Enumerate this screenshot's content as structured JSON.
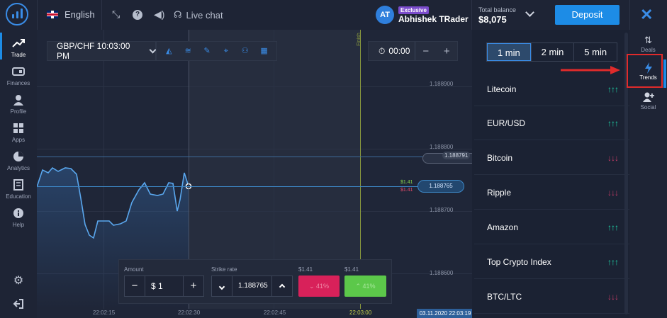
{
  "topbar": {
    "language": "English",
    "live_chat": "Live chat",
    "user_initials": "AT",
    "user_badge": "Exclusive",
    "user_name": "Abhishek TRader",
    "balance_label": "Total balance",
    "balance_value": "$8,075",
    "deposit_label": "Deposit"
  },
  "leftnav": [
    {
      "label": "Trade",
      "icon": "trend-icon"
    },
    {
      "label": "Finances",
      "icon": "wallet-icon"
    },
    {
      "label": "Profile",
      "icon": "user-icon"
    },
    {
      "label": "Apps",
      "icon": "grid-icon"
    },
    {
      "label": "Analytics",
      "icon": "pie-icon"
    },
    {
      "label": "Education",
      "icon": "book-icon"
    },
    {
      "label": "Help",
      "icon": "info-icon"
    }
  ],
  "chart": {
    "pair_label": "GBP/CHF 10:03:00 PM",
    "timer_value": "00:00",
    "finish_label": "Finish",
    "y_ticks": [
      "1.188900",
      "1.188800",
      "1.188700",
      "1.188600"
    ],
    "x_ticks": [
      "22:02:15",
      "22:02:30",
      "22:02:45",
      "22:03:00"
    ],
    "time_tag": "03.11.2020 22:03:19",
    "strike_tag": "1.188791",
    "current_tag": "1.188765",
    "payout_up": "$1.41",
    "payout_down": "$1.41",
    "colors": {
      "line": "#5aa7ee",
      "up": "#5cc84a",
      "down": "#d8215a"
    }
  },
  "trade_panel": {
    "amount_label": "Amount",
    "amount_value": "$ 1",
    "strike_label": "Strike rate",
    "strike_value": "1.188765",
    "payout_down_label": "$1.41",
    "payout_up_label": "$1.41",
    "down_pct": "41%",
    "up_pct": "41%"
  },
  "right_panel": {
    "timeframes": [
      "1 min",
      "2 min",
      "5 min"
    ],
    "assets": [
      {
        "name": "Litecoin",
        "trend": "↑↑↑",
        "color": "#1fd3a7"
      },
      {
        "name": "EUR/USD",
        "trend": "↑↑↑",
        "color": "#1fd3a7"
      },
      {
        "name": "Bitcoin",
        "trend": "↓↓↓",
        "color": "#c93c68"
      },
      {
        "name": "Ripple",
        "trend": "↓↓↓",
        "color": "#c93c68"
      },
      {
        "name": "Amazon",
        "trend": "↑↑↑",
        "color": "#1fd3a7"
      },
      {
        "name": "Top Crypto Index",
        "trend": "↑↑↑",
        "color": "#1fd3a7"
      },
      {
        "name": "BTC/LTC",
        "trend": "↓↓↓",
        "color": "#c93c68"
      }
    ]
  },
  "rightnav": [
    {
      "label": "Deals",
      "icon": "updown-icon"
    },
    {
      "label": "Trends",
      "icon": "lightning-icon"
    },
    {
      "label": "Social",
      "icon": "add-user-icon"
    }
  ]
}
